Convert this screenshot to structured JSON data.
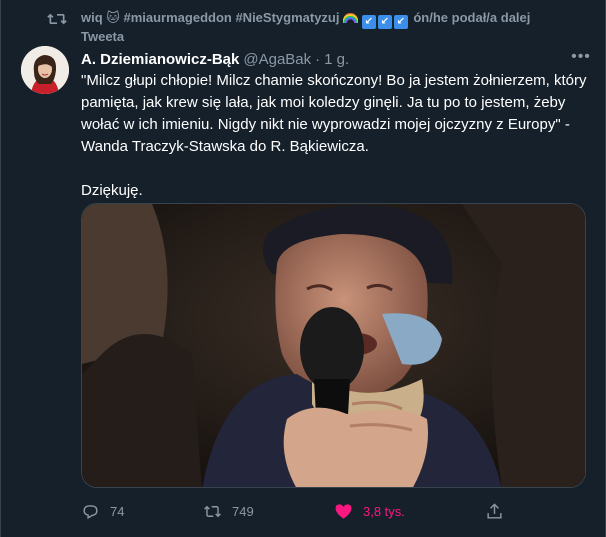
{
  "retweet_context": {
    "user": "wiq",
    "cat_emoji": "🐱",
    "hashtags": "#miaurmageddon #NieStygmatyzuj",
    "rainbow_emoji": "rainbow-flag-emoji",
    "arrow_emojis": [
      "↙",
      "↙",
      "↙"
    ],
    "suffix_line1": "ón/he podał/a dalej",
    "suffix_line2": "Tweeta"
  },
  "tweet": {
    "author_name": "A. Dziemianowicz-Bąk",
    "handle": "@AgaBak",
    "separator": "·",
    "time": "1 g.",
    "more_icon": "more-dots-icon",
    "paragraph1": "\"Milcz głupi chłopie! Milcz chamie skończony! Bo ja jestem żołnierzem, który pamięta, jak krew się lała, jak moi koledzy ginęli. Ja tu po to jestem, żeby wołać w ich imieniu. Nigdy nikt nie wyprowadzi mojej ojczyzny z Europy\" - Wanda Traczyk-Stawska do R. Bąkiewicza.",
    "paragraph2": "Dziękuję."
  },
  "actions": {
    "reply_count": "74",
    "retweet_count": "749",
    "like_count": "3,8 tys.",
    "like_color": "#f91880"
  },
  "colors": {
    "background": "#15202b",
    "border": "#38444d",
    "secondary_text": "#8b98a5",
    "primary_text": "#ffffff"
  }
}
